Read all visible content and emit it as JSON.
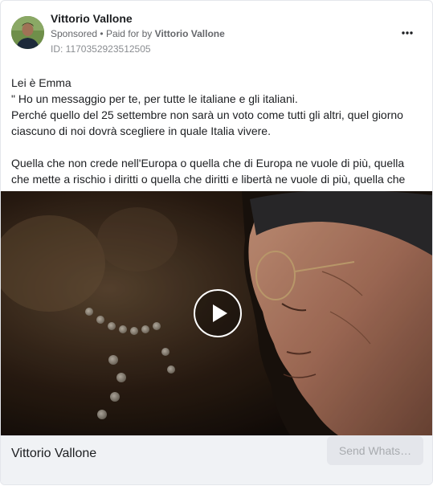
{
  "advertiser": {
    "name": "Vittorio Vallone",
    "sponsored_label": "Sponsored",
    "separator": "•",
    "paid_for_prefix": "Paid for by",
    "paid_for_name": "Vittorio Vallone",
    "ad_id": "ID: 1170352923512505"
  },
  "post": {
    "line1": "Lei è Emma",
    "line2": "\" Ho un messaggio per te, per tutte le italiane e gli italiani.",
    "line3": "Perché quello del 25 settembre non sarà un voto come tutti gli altri, quel giorno ciascuno di noi dovrà scegliere in quale Italia vivere.",
    "line4": "Quella che non crede nell'Europa o quella che di Europa ne vuole di più, quella che mette a rischio i diritti o quella che diritti e libertà ne vuole di più, quella che si…"
  },
  "media": {
    "type": "video",
    "play_icon": "play-icon"
  },
  "footer": {
    "name": "Vittorio Vallone",
    "cta_label": "Send Whats…"
  },
  "icons": {
    "more": "more-options-icon",
    "avatar": "avatar"
  },
  "colors": {
    "primary_text": "#1c1e21",
    "secondary_text": "#65676b",
    "footer_bg": "#f0f2f5",
    "cta_disabled_bg": "#e4e6eb"
  }
}
